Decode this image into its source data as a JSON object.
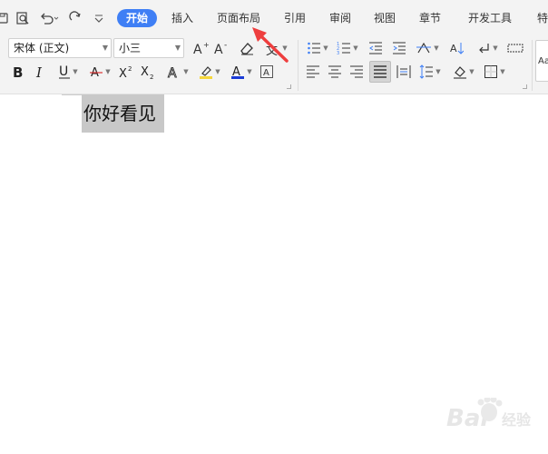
{
  "tabs": [
    {
      "label": "开始",
      "active": true
    },
    {
      "label": "插入"
    },
    {
      "label": "页面布局"
    },
    {
      "label": "引用"
    },
    {
      "label": "审阅"
    },
    {
      "label": "视图"
    },
    {
      "label": "章节"
    },
    {
      "label": "开发工具"
    },
    {
      "label": "特"
    }
  ],
  "quick_access": [
    "save-icon",
    "print-preview-icon",
    "undo-icon",
    "redo-icon",
    "customize-icon"
  ],
  "font": {
    "family": "宋体 (正文)",
    "size": "小三"
  },
  "styles_preview": "Aa",
  "document": {
    "selected_text": "你好看见"
  },
  "watermark": {
    "brand": "Bai",
    "suffix": "经验"
  },
  "colors": {
    "accent": "#3f7ff5",
    "arrow": "#ee3e3e",
    "selection": "#c8c8c8",
    "font_color_bar": "#1a3bd6",
    "highlight_bar": "#f5d63a"
  }
}
